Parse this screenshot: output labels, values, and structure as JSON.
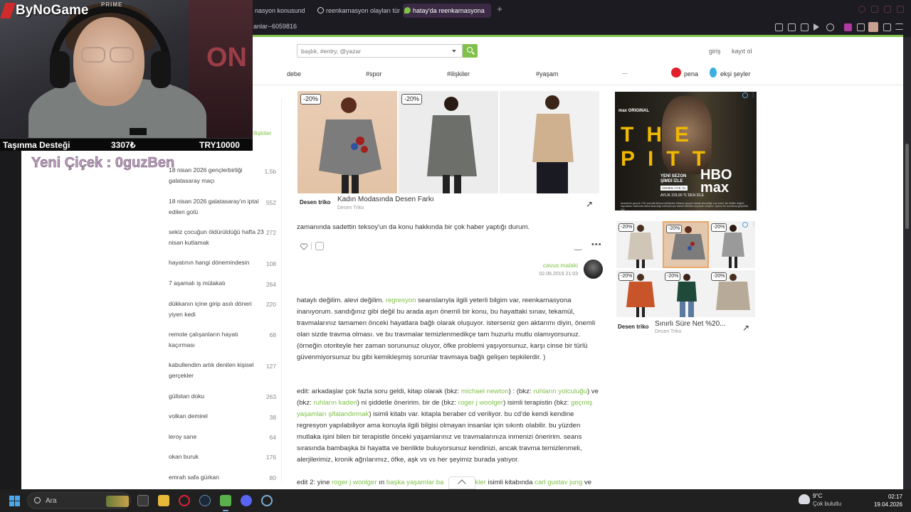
{
  "browser": {
    "tabs": [
      {
        "label": "nasyon konusund"
      },
      {
        "label": "reenkarnasyon olayları tür"
      },
      {
        "label": "hatay'da reenkarnasyona"
      }
    ],
    "address": "anlar--6059816"
  },
  "header": {
    "search_placeholder": "başlık, #entry, @yazar",
    "login": "giriş",
    "register": "kayıt ol"
  },
  "nav": {
    "items": [
      "debe",
      "#spor",
      "#ilişkiler",
      "#yaşam",
      "..."
    ],
    "pena": "pena",
    "eksi_seyler": "ekşi şeyler"
  },
  "sidebar": {
    "category": "ilişkiler",
    "items": [
      {
        "title": "18 nisan 2026 gençlerbirliği galatasaray maçı",
        "count": "1,5b"
      },
      {
        "title": "18 nisan 2026 galatasaray'ın iptal edilen golü",
        "count": "552"
      },
      {
        "title": "sekiz çocuğun öldürüldüğü hafta 23 nisan kutlamak",
        "count": "272"
      },
      {
        "title": "hayatının hangi dönemindesin",
        "count": "108"
      },
      {
        "title": "7 aşamalı iş mülakatı",
        "count": "264"
      },
      {
        "title": "dükkanın içine girip asılı döneri yiyen kedi",
        "count": "220"
      },
      {
        "title": "remote çalışanların hayatı kaçırması",
        "count": "68"
      },
      {
        "title": "kabullendim artık denilen kişisel gerçekler",
        "count": "127"
      },
      {
        "title": "gülistan doku",
        "count": "263"
      },
      {
        "title": "volkan demirel",
        "count": "38"
      },
      {
        "title": "leroy sane",
        "count": "64"
      },
      {
        "title": "okan buruk",
        "count": "176"
      },
      {
        "title": "emrah safa gürkan",
        "count": "80"
      }
    ]
  },
  "ad_top": {
    "discount": "-20%",
    "brand": "Desen triko",
    "title": "Kadın Modasında Desen Farkı",
    "sub": "Desen Triko"
  },
  "entry1": {
    "text": "zamanında sadettin teksoy'un da konu hakkında bir çok haber yaptığı durum.",
    "author": "cavus malaki",
    "date": "02.06.2019 21:03"
  },
  "entry2": {
    "p1_a": "hataylı değilim. alevi değilim. ",
    "p1_link": "regresyon",
    "p1_b": " seanslarıyla ilgili yeterli bilgim var, reenkarnasyona inanıyorum. sandığınız gibi değil bu arada aşın önemli bir konu, bu hayattaki sınav, tekamül, travmalarınız tamamen önceki hayatlara bağlı olarak oluşuyor. isterseniz gen aktarımı diyin, önemli olan sizde travma olması. ve bu travmalar temizlenmedikçe tam huzurlu mutlu olamıyorsunuz. (örneğin otoriteyle her zaman sorununuz oluyor, öfke problemi yaşıyorsunuz, karşı cinse bir türlü güvenmiyorsunuz bu gibi kemikleşmiş sorunlar travmaya bağlı gelişen tepkilerdir. )",
    "p2_a": "edit: arkadaşlar çok fazla soru geldi, kitap olarak (bkz: ",
    "p2_l1": "michael newton",
    "p2_b": ") : (bkz: ",
    "p2_l2": "ruhların yolculuğu",
    "p2_c": ") ve (bkz: ",
    "p2_l3": "ruhların kaderi",
    "p2_d": ") ni şiddetle öneririm. bir de (bkz: ",
    "p2_l4": "roger j woolger",
    "p2_e": ") isimli terapistin (bkz: ",
    "p2_l5": "geçmiş yaşamları şifalandırmak",
    "p2_f": ") isimli kitabı var. kitapla beraber cd veriliyor. bu cd'de kendi kendine regresyon yapılabiliyor ama konuyla ilgili bilgisi olmayan insanlar için sıkıntı olabilir. bu yüzden mutlaka işini bilen bir terapistle önceki yaşamlarınız ve travmalarınıza inmenizi öneririm. seans sırasında bambaşka bi hayatta ve benlikte buluyorsunuz kendinizi, ancak travma temizlenmeli, alerjilerimiz, kronik ağrılarımız, öfke, aşk vs vs her şeyimiz burada yatıyor.",
    "p3_a": "edit 2: yine ",
    "p3_l1": "roger j woolger",
    "p3_b": " ın ",
    "p3_l2": "başka yaşamlar ba",
    "p3_l2b": "kler",
    "p3_c": " isimli kitabında ",
    "p3_l3": "carl gustav jung",
    "p3_d": " ve"
  },
  "ad_right": {
    "network": "max ORIGINAL",
    "show": "THE PITT",
    "season": "YENİ SEZON ŞİMDİ İZLE",
    "cta": "HEMEN ÜYE OL",
    "brand": "HBO max",
    "price": "AYLIK 229,90 TL'DEN İZLE",
    "fine": "Akademik gerçek: Pitt, sonraki fikirsuz tarihinden itibaren geçerli olarak aboneliğe son bulur. Bu teklifin değeri; kaynakları hakkında daha fazla bilgi edinmek için sitede belirtilen koşulları izleyiniz. Ayrıca bir sınırlama geçerlidir. 18+"
  },
  "ad_right_products": {
    "discount": "-20%",
    "brand": "Desen triko",
    "title": "Sınırlı Süre Net %20...",
    "sub": "Desen Triko"
  },
  "stream": {
    "channel": "ByNoGame",
    "prime": "PRIME",
    "neon": "ON",
    "donation_label": "Taşınma Desteği",
    "donation_value": "3307₺",
    "donation_goal": "TRY10000",
    "follower_alert": "Yeni Çiçek : 0guzBen"
  },
  "taskbar": {
    "search": "Ara",
    "weather_temp": "9°C",
    "weather_desc": "Çok bulutlu",
    "time": "02:17",
    "date": "19.04.2026"
  },
  "colors": {
    "accent_green": "#81c14b",
    "pena_red": "#e0202a"
  }
}
